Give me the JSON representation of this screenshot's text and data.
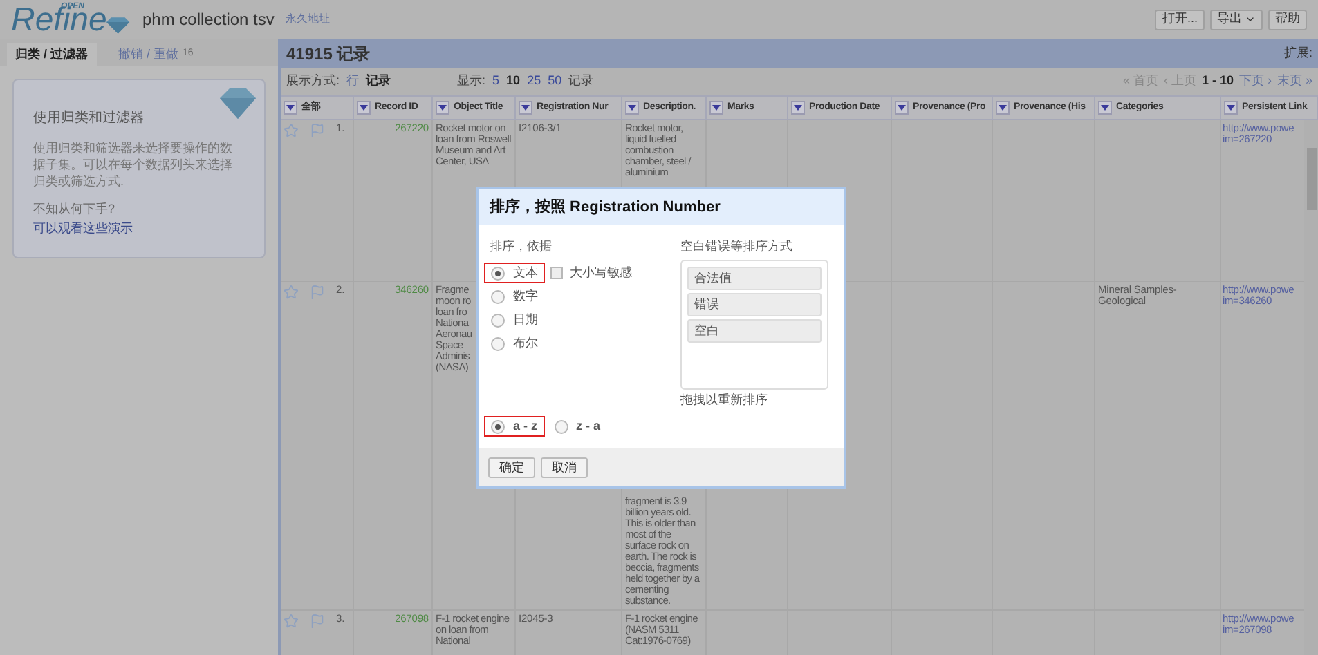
{
  "header": {
    "logo_badge": "OPEN",
    "logo_text": "Refine",
    "project_name": "phm collection tsv",
    "permalink": "永久地址",
    "buttons": [
      {
        "label": "打开...",
        "dropdown": false
      },
      {
        "label": "导出",
        "dropdown": true
      },
      {
        "label": "帮助",
        "dropdown": false
      }
    ]
  },
  "left_panel": {
    "tabs": [
      {
        "label": "归类 / 过滤器",
        "selected": true
      },
      {
        "label": "撤销 / 重做",
        "count": "16",
        "selected": false
      }
    ],
    "help_card": {
      "title": "使用归类和过滤器",
      "body": "使用归类和筛选器来选择要操作的数据子集。可以在每个数据列头来选择归类或筛选方式.",
      "question": "不知从何下手?",
      "link": "可以观看这些演示"
    }
  },
  "main": {
    "record_count": "41915 记录",
    "extensions_label": "扩展:",
    "view_label": "展示方式:",
    "view_modes": [
      {
        "label": "行",
        "selected": false
      },
      {
        "label": "记录",
        "selected": true
      }
    ],
    "show_label": "显示:",
    "page_sizes": [
      {
        "label": "5",
        "selected": false
      },
      {
        "label": "10",
        "selected": true
      },
      {
        "label": "25",
        "selected": false
      },
      {
        "label": "50",
        "selected": false
      }
    ],
    "show_suffix": "记录",
    "pager": {
      "first": "« 首页",
      "prev": "‹ 上页",
      "range": "1 - 10",
      "next": "下页 ›",
      "last": "末页 »"
    },
    "table": {
      "columns": [
        "全部",
        "Record ID",
        "Object Title",
        "Registration Nur",
        "Description.",
        "Marks",
        "Production Date",
        "Provenance (Pro",
        "Provenance (His",
        "Categories",
        "Persistent Link"
      ],
      "rows": [
        {
          "starred": false,
          "flagged": false,
          "index": "1.",
          "record_id": "267220",
          "object_title": [
            "Rocket motor on loan from Roswell Museum and Art Center, USA"
          ],
          "registration_number": "I2106-3/1",
          "description": {
            "text": "Rocket motor, liquid fuelled combustion chamber, steel / aluminium",
            "partly_hidden": false
          },
          "categories": "",
          "link": [
            "http://www.powe",
            "im=267220"
          ]
        },
        {
          "starred": false,
          "flagged": false,
          "index": "2.",
          "record_id": "346260",
          "object_title": [
            "Fragme",
            "moon ro",
            "loan fro",
            "Nationa",
            "Aeronau",
            "Space",
            "Adminis",
            "(NASA)"
          ],
          "registration_number": "",
          "description": {
            "text": "fragment is 3.9 billion years old. This is older than most of the surface rock on earth. The rock is beccia, fragments held together by a cementing substance.",
            "partly_hidden": true
          },
          "categories": "Mineral Samples-Geological",
          "link": [
            "http://www.powe",
            "im=346260"
          ]
        },
        {
          "starred": false,
          "flagged": false,
          "index": "3.",
          "record_id": "267098",
          "object_title": [
            "F-1 rocket engine on loan from National"
          ],
          "registration_number": "I2045-3",
          "description": {
            "text": "F-1 rocket engine (NASM 5311 Cat:1976-0769)",
            "partly_hidden": false
          },
          "categories": "",
          "link": [
            "http://www.powe",
            "im=267098"
          ]
        }
      ]
    }
  },
  "dialog": {
    "title": "排序，按照 Registration Number",
    "sort_by_label": "排序，依据",
    "sort_types": [
      {
        "label": "文本",
        "selected": true,
        "highlighted": true
      },
      {
        "label": "数字",
        "selected": false,
        "highlighted": false
      },
      {
        "label": "日期",
        "selected": false,
        "highlighted": false
      },
      {
        "label": "布尔",
        "selected": false,
        "highlighted": false
      }
    ],
    "case_sensitive": {
      "label": "大小写敏感",
      "checked": false
    },
    "order_label": "空白错误等排序方式",
    "order_items": [
      "合法值",
      "错误",
      "空白"
    ],
    "order_hint": "拖拽以重新排序",
    "directions": [
      {
        "label": "a - z",
        "selected": true,
        "highlighted": true
      },
      {
        "label": "z - a",
        "selected": false,
        "highlighted": false
      }
    ],
    "buttons": [
      "确定",
      "取消"
    ]
  }
}
